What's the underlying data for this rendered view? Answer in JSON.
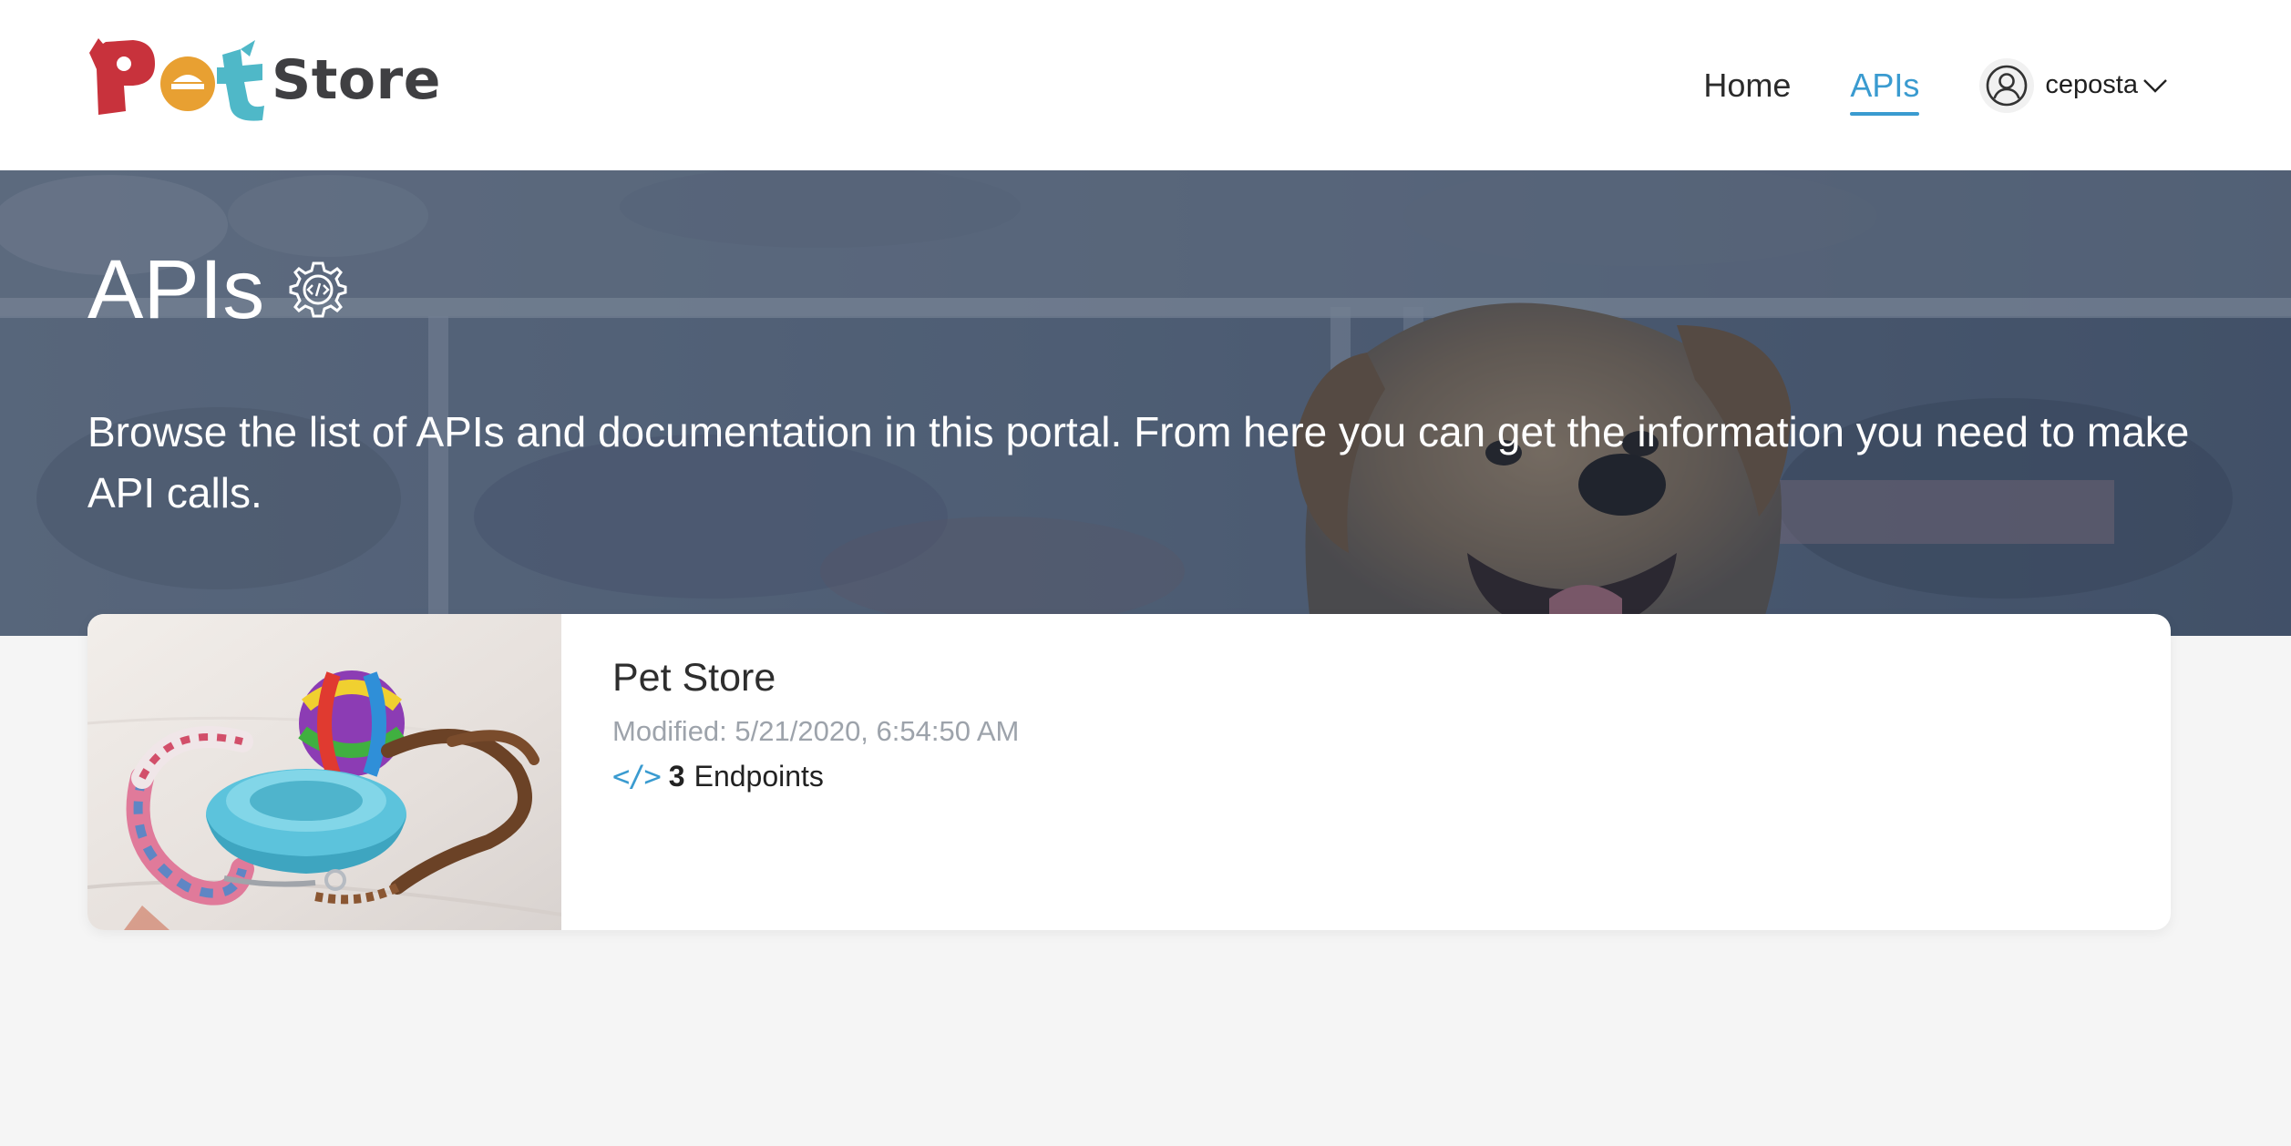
{
  "brand": {
    "name": "Pet Store",
    "logo_text": "Store",
    "logo_mark": "Pet"
  },
  "nav": {
    "items": [
      {
        "label": "Home",
        "active": false
      },
      {
        "label": "APIs",
        "active": true
      }
    ],
    "user": {
      "name": "ceposta",
      "avatar_icon": "user-circle-icon",
      "menu_icon": "chevron-down-icon"
    }
  },
  "hero": {
    "title": "APIs",
    "title_icon": "gear-code-icon",
    "description": "Browse the list of APIs and documentation in this portal. From here you can get the information you need to make API calls."
  },
  "apis": [
    {
      "name": "Pet Store",
      "modified": "Modified: 5/21/2020, 6:54:50 AM",
      "endpoint_icon": "</>",
      "endpoint_count": "3",
      "endpoint_label": "Endpoints"
    }
  ],
  "colors": {
    "accent": "#3a9bd0",
    "header_bg": "#ffffff",
    "page_bg": "#f5f5f5",
    "logo_red": "#c8323c",
    "logo_orange": "#e8a032",
    "logo_teal": "#4fb8c8",
    "logo_text": "#3f3f42",
    "muted_text": "#9da3ab"
  }
}
